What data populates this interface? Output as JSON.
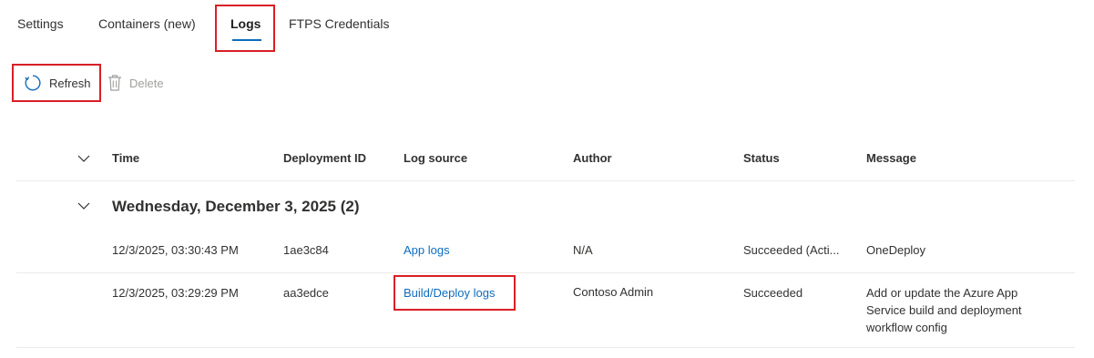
{
  "tabs": [
    {
      "label": "Settings"
    },
    {
      "label": "Containers (new)"
    },
    {
      "label": "Logs"
    },
    {
      "label": "FTPS Credentials"
    }
  ],
  "toolbar": {
    "refresh_label": "Refresh",
    "delete_label": "Delete"
  },
  "table": {
    "columns": [
      "Time",
      "Deployment ID",
      "Log source",
      "Author",
      "Status",
      "Message"
    ],
    "group": {
      "title": "Wednesday, December 3, 2025 (2)"
    },
    "rows": [
      {
        "time": "12/3/2025, 03:30:43 PM",
        "deployment_id": "1ae3c84",
        "log_source": "App logs",
        "author": "N/A",
        "status": "Succeeded (Acti...",
        "message": "OneDeploy"
      },
      {
        "time": "12/3/2025, 03:29:29 PM",
        "deployment_id": "aa3edce",
        "log_source": "Build/Deploy logs",
        "author": "Contoso Admin",
        "status": "Succeeded",
        "message": "Add or update the Azure App Service build and deployment workflow config"
      }
    ]
  },
  "colors": {
    "accent": "#0f6cbd",
    "highlight": "#d91f26",
    "divider": "#edebe9",
    "disabled": "#a19f9d"
  }
}
